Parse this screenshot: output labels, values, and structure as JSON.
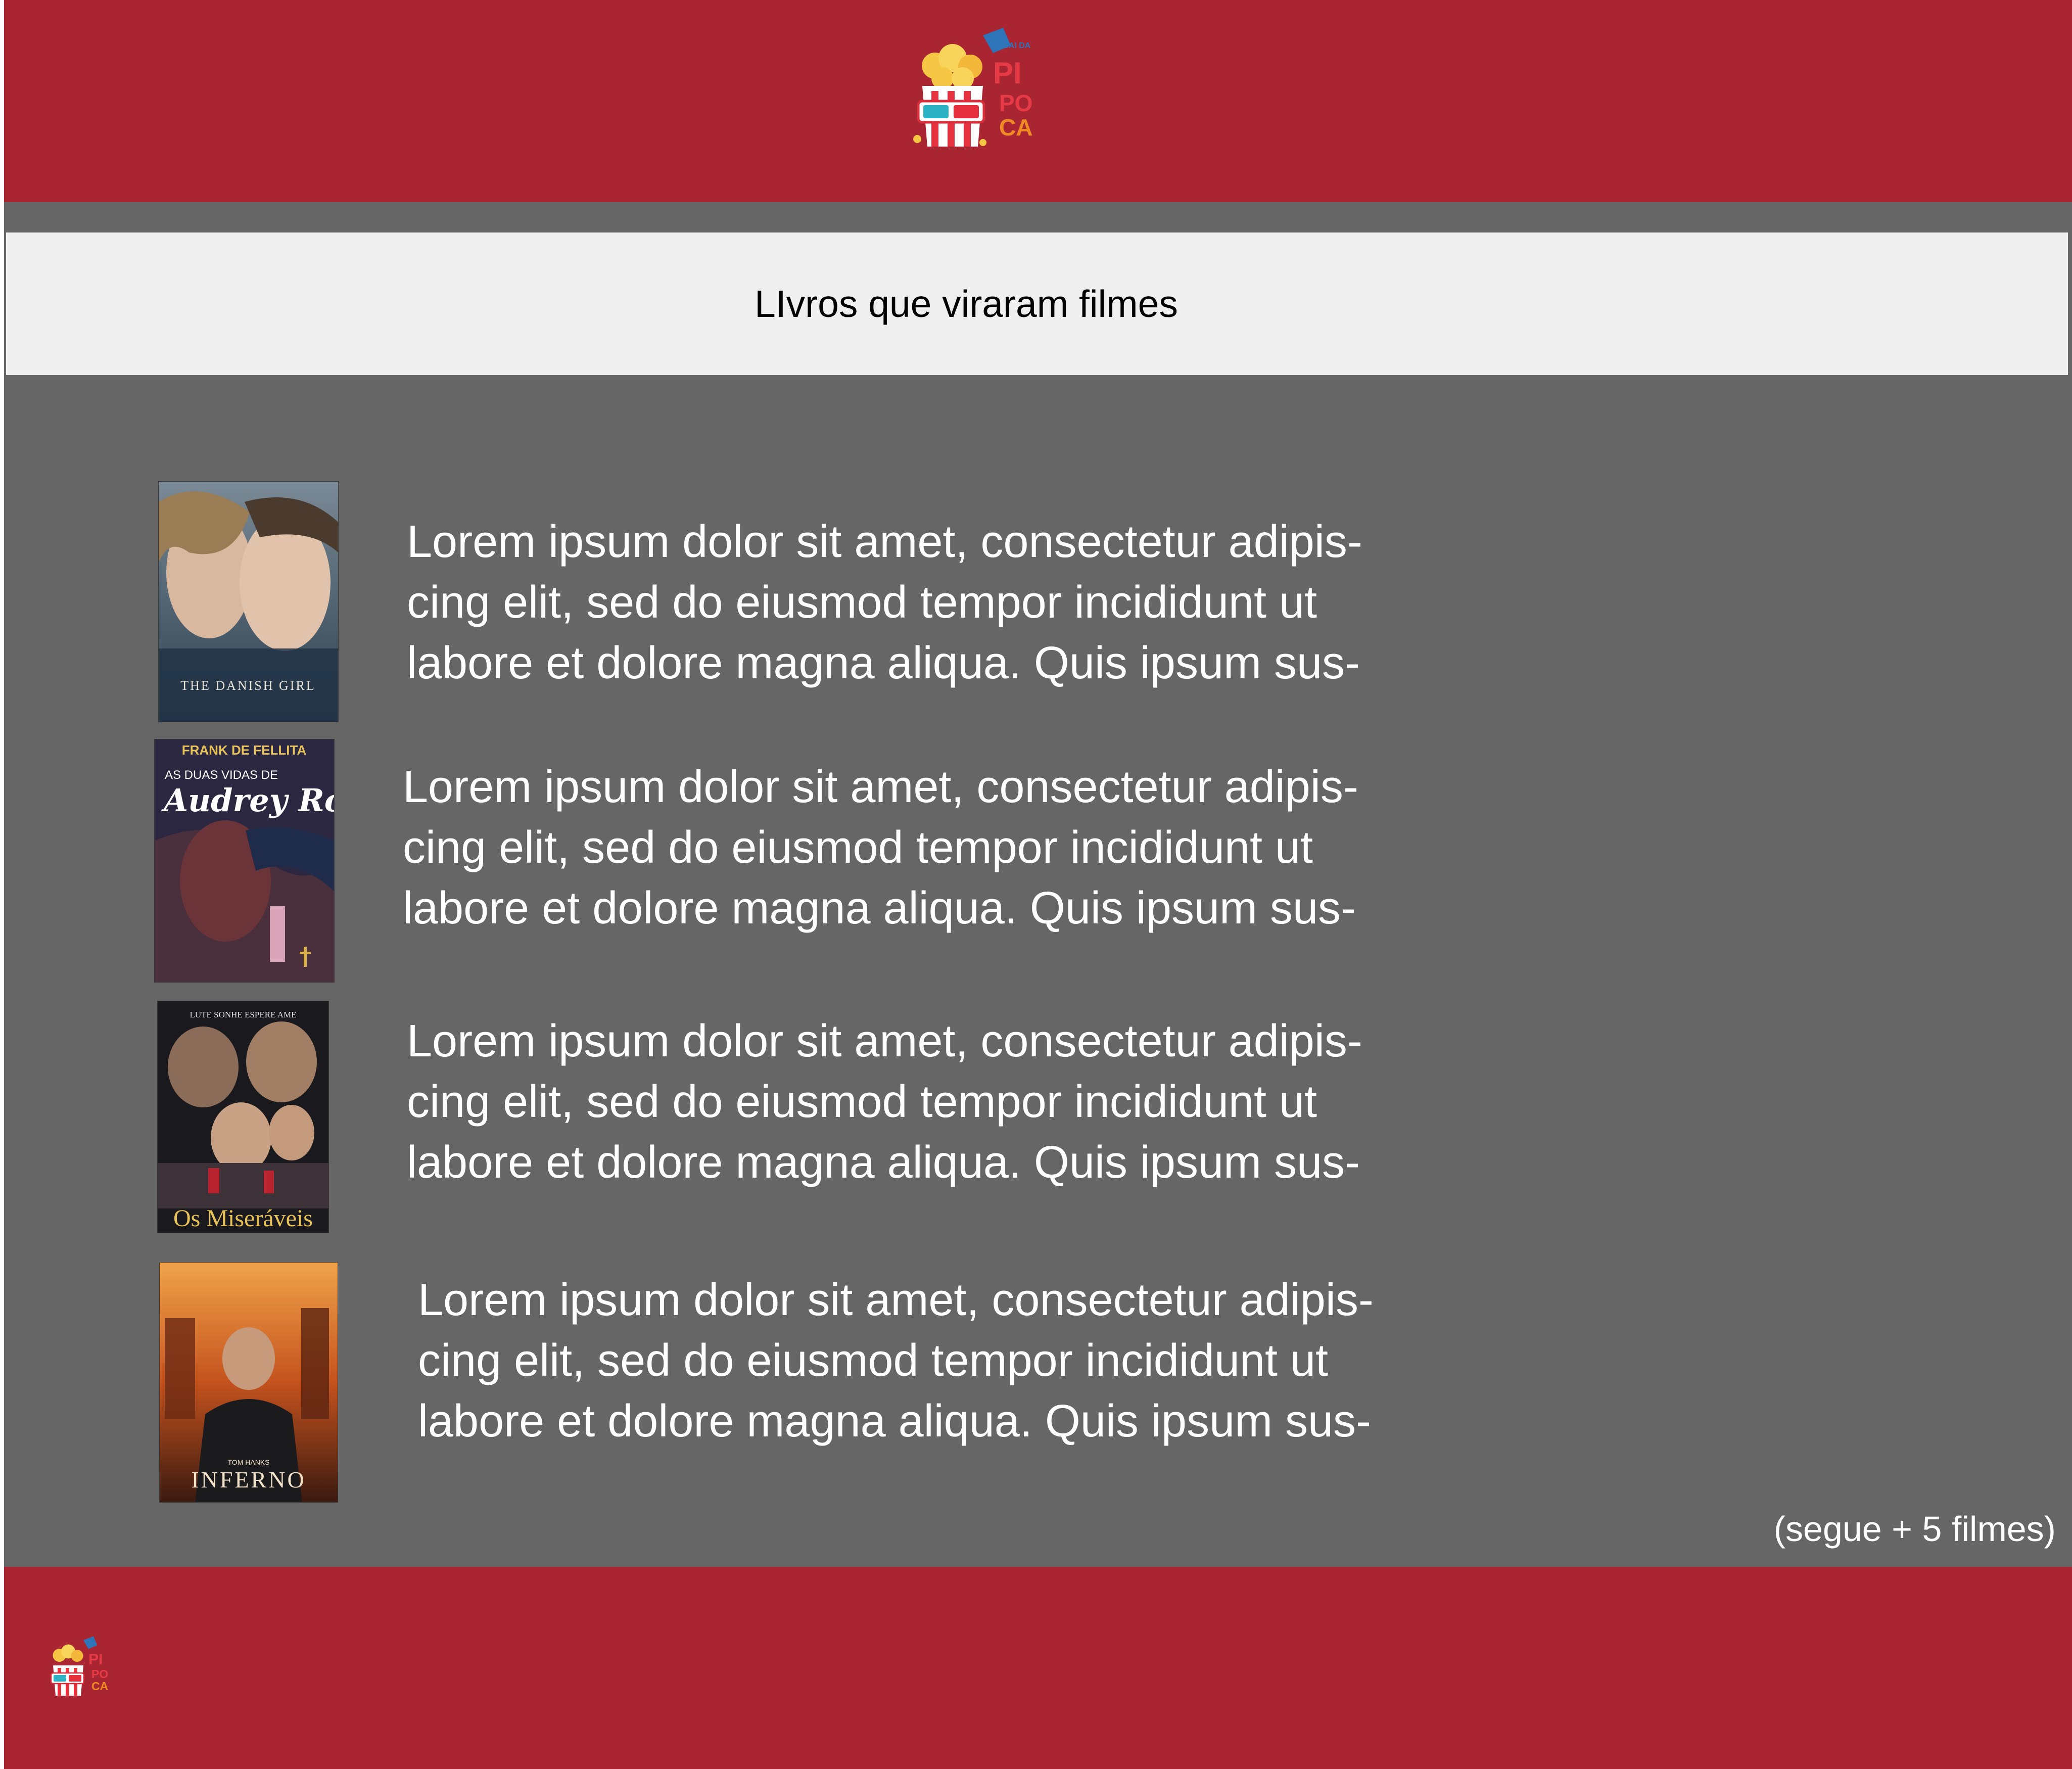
{
  "header": {
    "logo_icon": "popcorn-3d-glasses-logo"
  },
  "logo": {
    "line1": "PI",
    "line2": "PO",
    "line3": "CA",
    "tagline": "SAI DA"
  },
  "section": {
    "title": "LIvros que viraram filmes"
  },
  "movies": [
    {
      "poster_title": "THE DANISH GIRL",
      "desc_lines": [
        "Lorem ipsum dolor sit amet, consectetur adipis-",
        "cing elit, sed do eiusmod tempor incididunt ut",
        "labore et dolore magna aliqua. Quis ipsum sus-"
      ]
    },
    {
      "poster_author": "FRANK DE FELLITA",
      "poster_pre": "AS DUAS VIDAS DE",
      "poster_title": "Audrey Rose",
      "desc_lines": [
        "Lorem ipsum dolor sit amet, consectetur adipis-",
        "cing elit, sed do eiusmod tempor incididunt ut",
        "labore et dolore magna aliqua. Quis ipsum sus-"
      ]
    },
    {
      "poster_tagline": "LUTE  SONHE  ESPERE  AME",
      "poster_title": "Os Miseráveis",
      "desc_lines": [
        "Lorem ipsum dolor sit amet, consectetur adipis-",
        "cing elit, sed do eiusmod tempor incididunt ut",
        "labore et dolore magna aliqua. Quis ipsum sus-"
      ]
    },
    {
      "poster_actor": "TOM HANKS",
      "poster_title": "INFERNO",
      "desc_lines": [
        "Lorem ipsum dolor sit amet, consectetur adipis-",
        "cing elit, sed do eiusmod tempor incididunt ut",
        "labore et dolore magna aliqua. Quis ipsum sus-"
      ]
    }
  ],
  "more_text": "(segue + 5 filmes)",
  "colors": {
    "brand_red": "#a92531",
    "content_grey": "#666666",
    "title_bar": "#efefef"
  }
}
